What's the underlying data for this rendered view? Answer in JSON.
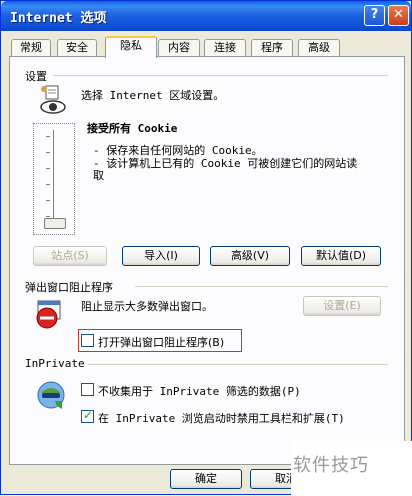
{
  "window": {
    "title": "Internet 选项",
    "help_glyph": "?",
    "close_glyph": "✕"
  },
  "tabs": [
    {
      "label": "常规"
    },
    {
      "label": "安全"
    },
    {
      "label": "隐私"
    },
    {
      "label": "内容"
    },
    {
      "label": "连接"
    },
    {
      "label": "程序"
    },
    {
      "label": "高级"
    }
  ],
  "active_tab": "隐私",
  "settings": {
    "heading": "设置",
    "description": "选择 Internet 区域设置。",
    "level_title": "接受所有 Cookie",
    "bullets": [
      "- 保存来自任何网站的 Cookie。",
      "- 该计算机上已有的 Cookie 可被创建它们的网站读",
      "取"
    ],
    "slider_position": "bottom",
    "buttons": {
      "sites": "站点(S)",
      "import": "导入(I)",
      "advanced": "高级(V)",
      "default": "默认值(D)"
    }
  },
  "popup": {
    "heading": "弹出窗口阻止程序",
    "description": "阻止显示大多数弹出窗口。",
    "settings_button": "设置(E)",
    "enable_checkbox": {
      "label": "打开弹出窗口阻止程序(B)",
      "checked": false
    }
  },
  "inprivate": {
    "heading": "InPrivate",
    "no_collect": {
      "label": "不收集用于 InPrivate 筛选的数据(P)",
      "checked": false
    },
    "disable_toolbars": {
      "label": "在 InPrivate 浏览启动时禁用工具栏和扩展(T)",
      "checked": true
    }
  },
  "footer": {
    "ok": "确定",
    "cancel": "取消"
  },
  "watermark": "软件技巧"
}
